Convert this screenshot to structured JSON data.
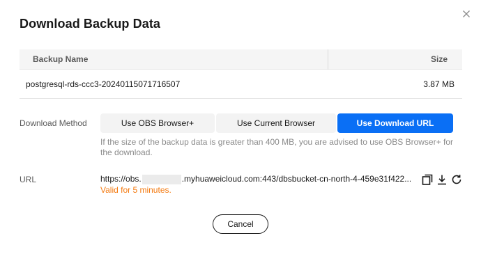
{
  "dialog": {
    "title": "Download Backup Data",
    "close_icon": "close-icon"
  },
  "table": {
    "columns": [
      "Backup Name",
      "Size"
    ],
    "rows": [
      {
        "name": "postgresql-rds-ccc3-20240115071716507",
        "size": "3.87 MB"
      }
    ]
  },
  "download_method": {
    "label": "Download Method",
    "options": [
      "Use OBS Browser+",
      "Use Current Browser",
      "Use Download URL"
    ],
    "selected": "Use Download URL",
    "hint": "If the size of the backup data is greater than 400 MB, you are advised to use OBS Browser+ for the download."
  },
  "url": {
    "label": "URL",
    "prefix": "https://obs.",
    "suffix": ".myhuaweicloud.com:443/dbsbucket-cn-north-4-459e31f422...",
    "validity": "Valid for 5 minutes.",
    "actions": [
      "copy-icon",
      "download-icon",
      "refresh-icon"
    ]
  },
  "footer": {
    "cancel_label": "Cancel"
  },
  "colors": {
    "primary": "#0a6ff5",
    "warning": "#f47a10",
    "text": "#191919",
    "muted": "#8a8a8a"
  }
}
